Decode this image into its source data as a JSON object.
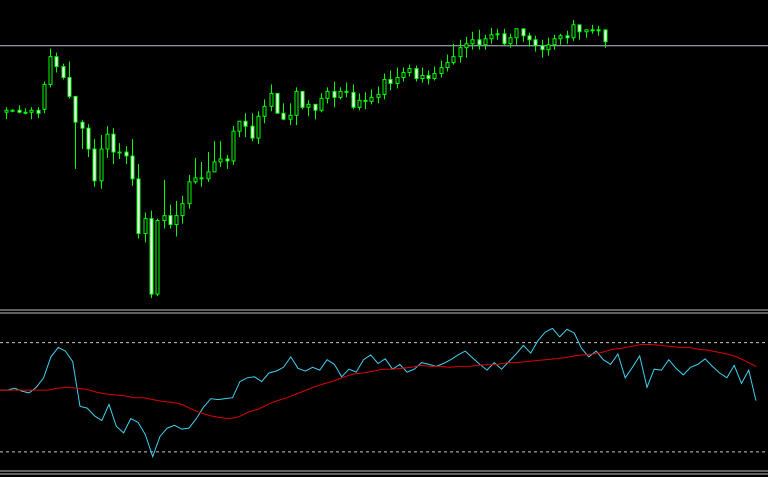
{
  "colors": {
    "background": "#000000",
    "candle_wick": "#00ff00",
    "candle_bull": "#000000",
    "candle_bear": "#ffffff",
    "price_line": "#b8bfcf",
    "pane_separator": "#c0c0c0",
    "oscillator_line": "#40d0f0",
    "signal_line": "#e00000",
    "level_lines": "#c8c8c8"
  },
  "chart_data": [
    {
      "type": "candlestick",
      "title": "",
      "grid": false,
      "ylim": [
        0,
        310
      ],
      "horizontal_line": 264,
      "candles": [
        [
          197,
          199,
          190,
          202
        ],
        [
          199,
          199,
          197,
          200
        ],
        [
          199,
          197,
          196,
          204
        ],
        [
          197,
          197,
          195,
          201
        ],
        [
          197,
          199,
          190,
          202
        ],
        [
          199,
          196,
          191,
          202
        ],
        [
          200,
          225,
          196,
          228
        ],
        [
          225,
          253,
          222,
          261
        ],
        [
          253,
          243,
          237,
          257
        ],
        [
          243,
          232,
          230,
          246
        ],
        [
          232,
          213,
          211,
          248
        ],
        [
          213,
          187,
          140,
          190
        ],
        [
          187,
          181,
          160,
          189
        ],
        [
          181,
          160,
          152,
          185
        ],
        [
          160,
          128,
          122,
          170
        ],
        [
          128,
          160,
          120,
          174
        ],
        [
          160,
          175,
          151,
          183
        ],
        [
          175,
          157,
          145,
          181
        ],
        [
          157,
          157,
          150,
          166
        ],
        [
          157,
          153,
          145,
          163
        ],
        [
          153,
          130,
          123,
          170
        ],
        [
          130,
          75,
          70,
          145
        ],
        [
          75,
          90,
          66,
          96
        ],
        [
          90,
          14,
          10,
          98
        ],
        [
          14,
          88,
          12,
          90
        ],
        [
          88,
          93,
          80,
          129
        ],
        [
          93,
          84,
          80,
          104
        ],
        [
          84,
          93,
          72,
          108
        ],
        [
          93,
          105,
          85,
          113
        ],
        [
          105,
          127,
          100,
          134
        ],
        [
          127,
          131,
          125,
          151
        ],
        [
          131,
          130,
          122,
          147
        ],
        [
          130,
          137,
          127,
          157
        ],
        [
          137,
          147,
          137,
          168
        ],
        [
          147,
          150,
          142,
          168
        ],
        [
          150,
          148,
          140,
          154
        ],
        [
          148,
          178,
          144,
          183
        ],
        [
          178,
          188,
          172,
          187
        ],
        [
          188,
          183,
          172,
          196
        ],
        [
          183,
          171,
          168,
          196
        ],
        [
          171,
          193,
          165,
          198
        ],
        [
          193,
          203,
          186,
          210
        ],
        [
          203,
          216,
          198,
          225
        ],
        [
          216,
          196,
          196,
          214
        ],
        [
          196,
          190,
          189,
          206
        ],
        [
          190,
          194,
          184,
          206
        ],
        [
          194,
          218,
          184,
          222
        ],
        [
          218,
          202,
          200,
          216
        ],
        [
          202,
          205,
          193,
          209
        ],
        [
          205,
          199,
          190,
          205
        ],
        [
          199,
          211,
          197,
          216
        ],
        [
          211,
          218,
          206,
          222
        ],
        [
          218,
          212,
          202,
          228
        ],
        [
          212,
          218,
          210,
          222
        ],
        [
          218,
          217,
          212,
          227
        ],
        [
          217,
          202,
          200,
          225
        ],
        [
          202,
          209,
          199,
          216
        ],
        [
          209,
          208,
          200,
          217
        ],
        [
          208,
          212,
          205,
          220
        ],
        [
          212,
          215,
          206,
          223
        ],
        [
          215,
          230,
          210,
          236
        ],
        [
          230,
          226,
          219,
          239
        ],
        [
          226,
          232,
          221,
          242
        ],
        [
          232,
          237,
          228,
          242
        ],
        [
          237,
          241,
          233,
          245
        ],
        [
          241,
          231,
          228,
          244
        ],
        [
          231,
          234,
          227,
          242
        ],
        [
          234,
          231,
          225,
          239
        ],
        [
          231,
          236,
          229,
          243
        ],
        [
          236,
          242,
          232,
          249
        ],
        [
          242,
          247,
          238,
          255
        ],
        [
          247,
          253,
          245,
          266
        ],
        [
          253,
          262,
          247,
          270
        ],
        [
          262,
          266,
          252,
          273
        ],
        [
          266,
          270,
          260,
          278
        ],
        [
          270,
          265,
          260,
          280
        ],
        [
          265,
          271,
          260,
          275
        ],
        [
          271,
          275,
          266,
          282
        ],
        [
          275,
          276,
          270,
          281
        ],
        [
          276,
          266,
          264,
          281
        ],
        [
          266,
          272,
          262,
          276
        ],
        [
          272,
          281,
          265,
          280
        ],
        [
          281,
          274,
          268,
          280
        ],
        [
          274,
          270,
          263,
          277
        ],
        [
          270,
          264,
          258,
          274
        ],
        [
          264,
          260,
          252,
          270
        ],
        [
          260,
          265,
          254,
          272
        ],
        [
          265,
          271,
          260,
          275
        ],
        [
          271,
          274,
          265,
          276
        ],
        [
          274,
          272,
          266,
          279
        ],
        [
          272,
          285,
          269,
          290
        ],
        [
          285,
          278,
          270,
          285
        ],
        [
          278,
          280,
          272,
          280
        ],
        [
          280,
          279,
          276,
          285
        ],
        [
          279,
          280,
          274,
          284
        ],
        [
          280,
          268,
          262,
          279
        ]
      ]
    },
    {
      "type": "line",
      "title": "",
      "grid": false,
      "ylim": [
        0,
        160
      ],
      "levels": [
        132,
        17
      ],
      "series": [
        {
          "values": [
            82,
            82,
            84,
            81,
            79,
            85,
            95,
            117,
            127,
            123,
            112,
            65,
            63,
            55,
            50,
            67,
            44,
            37,
            52,
            48,
            35,
            12,
            33,
            42,
            45,
            41,
            42,
            52,
            64,
            73,
            72,
            73,
            74,
            91,
            95,
            96,
            91,
            100,
            102,
            106,
            117,
            105,
            102,
            106,
            103,
            114,
            109,
            96,
            104,
            101,
            114,
            119,
            110,
            115,
            104,
            109,
            101,
            104,
            111,
            109,
            107,
            110,
            114,
            119,
            123,
            116,
            109,
            103,
            111,
            104,
            112,
            120,
            129,
            121,
            134,
            143,
            147,
            138,
            146,
            142,
            126,
            117,
            123,
            114,
            109,
            120,
            95,
            106,
            118,
            85,
            104,
            103,
            114,
            105,
            98,
            106,
            109,
            115,
            107,
            100,
            95,
            108,
            89,
            103,
            71
          ]
        },
        {
          "values": [
            82,
            82,
            82,
            82,
            82,
            82,
            84,
            85,
            84,
            83,
            80,
            78,
            77,
            76,
            74,
            74,
            72,
            70,
            69,
            67,
            62,
            58,
            55,
            53,
            52,
            54,
            59,
            62,
            67,
            71,
            74,
            78,
            82,
            86,
            89,
            92,
            96,
            99,
            100,
            102,
            104,
            104,
            105,
            106,
            108,
            107,
            107,
            106,
            107,
            107,
            108,
            109,
            109,
            111,
            111,
            112,
            113,
            114,
            115,
            116,
            118,
            119,
            120,
            122,
            125,
            126,
            128,
            130,
            130,
            129,
            128,
            127,
            127,
            125,
            124,
            122,
            120,
            117,
            112,
            107
          ]
        }
      ]
    }
  ]
}
